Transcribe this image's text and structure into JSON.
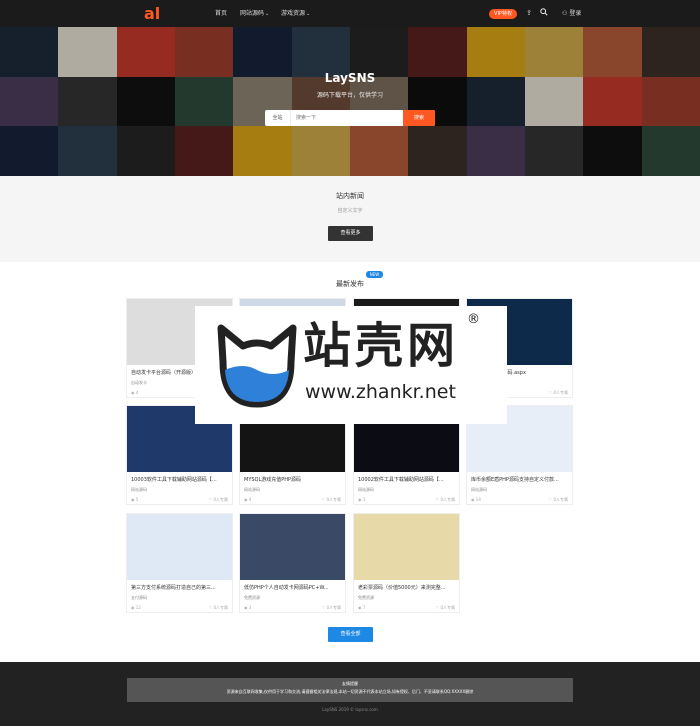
{
  "topbar": {
    "logo": "al",
    "nav": [
      {
        "label": "首页"
      },
      {
        "label": "网站源码",
        "has_dropdown": true
      },
      {
        "label": "游戏资源",
        "has_dropdown": true
      }
    ],
    "vip_label": "VIP特权",
    "upload_icon": "upload-icon",
    "search_icon": "search-icon",
    "login_label": "登录"
  },
  "hero": {
    "title": "LaySNS",
    "subtitle": "源码下载平台，仅供学习",
    "search": {
      "category": "全站",
      "placeholder": "搜索一下",
      "button": "搜索"
    }
  },
  "news": {
    "title": "站内新闻",
    "subtitle": "自定义文字",
    "more_button": "查看更多"
  },
  "latest": {
    "title": "最新发布",
    "badge": "NEW",
    "cards": [
      {
        "title": "自动发卡平台源码（开源版）仿万卡自动发卡模板修复已知漏洞",
        "category": "自动发卡",
        "views": "4",
        "likes": "0人专属"
      },
      {
        "title": "",
        "category": "",
        "views": "",
        "likes": ""
      },
      {
        "title": "",
        "category": "",
        "views": "",
        "likes": ""
      },
      {
        "title": "ipt收费下载站源码.aspx",
        "category": "",
        "views": "",
        "likes": "0人专属"
      },
      {
        "title": "10003软件工具下载辅助网站源码【...",
        "category": "网站源码",
        "views": "5",
        "likes": "0人专属"
      },
      {
        "title": "MYSQL游戏充值PHP源码",
        "category": "网站源码",
        "views": "4",
        "likes": "0人专属"
      },
      {
        "title": "10002软件工具下载辅助网站源码【...",
        "category": "网站源码",
        "views": "3",
        "likes": "0人专属"
      },
      {
        "title": "库币余额E盾PHP源码支持自定义付款...",
        "category": "网站源码",
        "views": "14",
        "likes": "0人专属"
      },
      {
        "title": "第三方支付系统源码打造自己的第三...",
        "category": "支付源码",
        "views": "12",
        "likes": "0人专属"
      },
      {
        "title": "低仿PHP个人自动发卡网源码PC+W...",
        "category": "免费资源",
        "views": "3",
        "likes": "0人专属"
      },
      {
        "title": "老彩票源码（价值5000元）来测完整...",
        "category": "免费资源",
        "views": "7",
        "likes": "0人专属"
      }
    ],
    "view_all_button": "查看全部"
  },
  "footer": {
    "notice_title": "友情提醒",
    "notice_text": "资源来自互联网收集,仅供用于学习和交流,请遵循相关法律法规,本站一切资源不代表本站立场,如有侵权、后门、不妥请联系QQ:XXXXX删除",
    "copyright": "LaySNS 2019 © laysns.com"
  },
  "watermark": {
    "cn": "站壳网",
    "en": "www.zhankr.net",
    "reg": "®"
  },
  "colors": {
    "accent": "#ff5722",
    "blue": "#1e88e5",
    "topbar": "#1b1b1b",
    "footer": "#222222"
  }
}
